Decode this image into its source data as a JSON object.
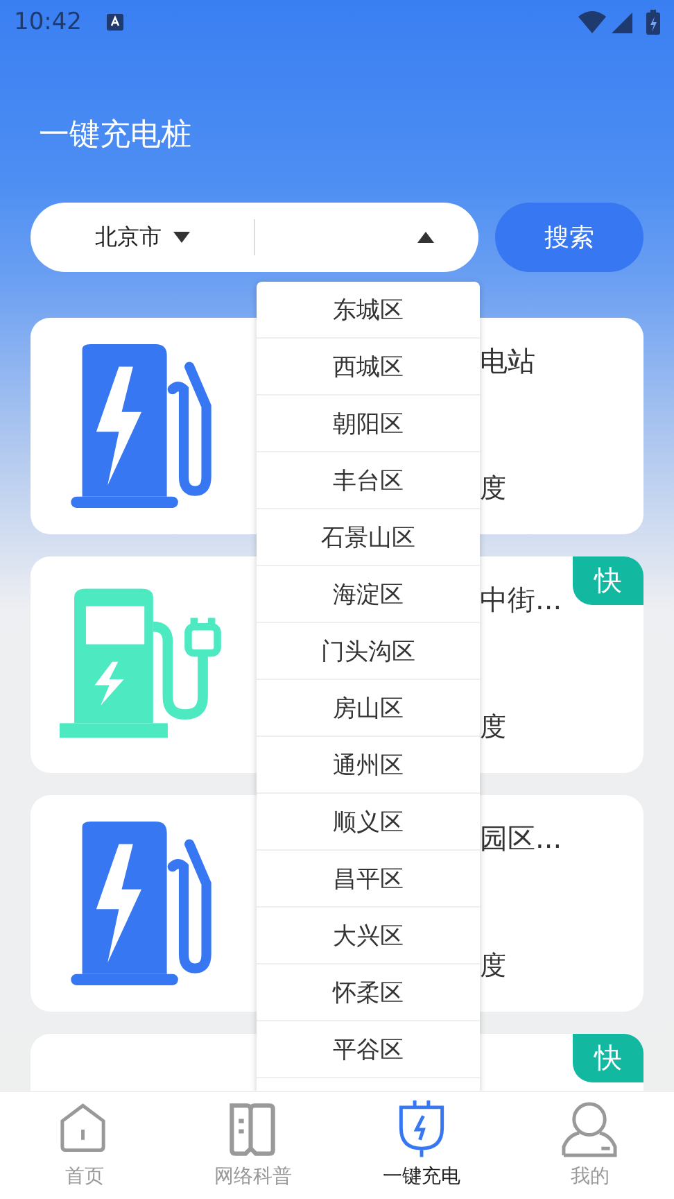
{
  "status_bar": {
    "time": "10:42"
  },
  "title": "一键充电桩",
  "search": {
    "city": "北京市",
    "district_expanded": true,
    "button": "搜索"
  },
  "district_options": [
    {
      "label": "东城区",
      "selected": false
    },
    {
      "label": "西城区",
      "selected": false
    },
    {
      "label": "朝阳区",
      "selected": false
    },
    {
      "label": "丰台区",
      "selected": false
    },
    {
      "label": "石景山区",
      "selected": false
    },
    {
      "label": "海淀区",
      "selected": false
    },
    {
      "label": "门头沟区",
      "selected": false
    },
    {
      "label": "房山区",
      "selected": false
    },
    {
      "label": "通州区",
      "selected": false
    },
    {
      "label": "顺义区",
      "selected": false
    },
    {
      "label": "昌平区",
      "selected": false
    },
    {
      "label": "大兴区",
      "selected": false
    },
    {
      "label": "怀柔区",
      "selected": false
    },
    {
      "label": "平谷区",
      "selected": false
    }
  ],
  "stations": [
    {
      "kind": "pump",
      "name": "电站",
      "detail": "度"
    },
    {
      "kind": "plug",
      "name": "中街...",
      "detail": "度",
      "badge": "快"
    },
    {
      "kind": "pump",
      "name": "园区...",
      "detail": "度"
    },
    {
      "badge": "快"
    }
  ],
  "nav": [
    {
      "kind": "home",
      "label": "首页",
      "selected": false
    },
    {
      "kind": "book",
      "label": "网络科普",
      "selected": false
    },
    {
      "kind": "plug",
      "label": "一键充电",
      "selected": true
    },
    {
      "kind": "user",
      "label": "我的",
      "selected": false
    }
  ]
}
